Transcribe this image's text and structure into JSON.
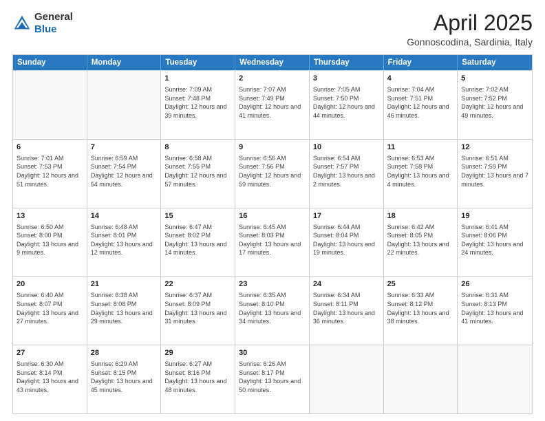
{
  "header": {
    "logo_general": "General",
    "logo_blue": "Blue",
    "month_title": "April 2025",
    "location": "Gonnoscodina, Sardinia, Italy"
  },
  "days": [
    "Sunday",
    "Monday",
    "Tuesday",
    "Wednesday",
    "Thursday",
    "Friday",
    "Saturday"
  ],
  "weeks": [
    [
      {
        "day": "",
        "info": ""
      },
      {
        "day": "",
        "info": ""
      },
      {
        "day": "1",
        "info": "Sunrise: 7:09 AM\nSunset: 7:48 PM\nDaylight: 12 hours and 39 minutes."
      },
      {
        "day": "2",
        "info": "Sunrise: 7:07 AM\nSunset: 7:49 PM\nDaylight: 12 hours and 41 minutes."
      },
      {
        "day": "3",
        "info": "Sunrise: 7:05 AM\nSunset: 7:50 PM\nDaylight: 12 hours and 44 minutes."
      },
      {
        "day": "4",
        "info": "Sunrise: 7:04 AM\nSunset: 7:51 PM\nDaylight: 12 hours and 46 minutes."
      },
      {
        "day": "5",
        "info": "Sunrise: 7:02 AM\nSunset: 7:52 PM\nDaylight: 12 hours and 49 minutes."
      }
    ],
    [
      {
        "day": "6",
        "info": "Sunrise: 7:01 AM\nSunset: 7:53 PM\nDaylight: 12 hours and 51 minutes."
      },
      {
        "day": "7",
        "info": "Sunrise: 6:59 AM\nSunset: 7:54 PM\nDaylight: 12 hours and 54 minutes."
      },
      {
        "day": "8",
        "info": "Sunrise: 6:58 AM\nSunset: 7:55 PM\nDaylight: 12 hours and 57 minutes."
      },
      {
        "day": "9",
        "info": "Sunrise: 6:56 AM\nSunset: 7:56 PM\nDaylight: 12 hours and 59 minutes."
      },
      {
        "day": "10",
        "info": "Sunrise: 6:54 AM\nSunset: 7:57 PM\nDaylight: 13 hours and 2 minutes."
      },
      {
        "day": "11",
        "info": "Sunrise: 6:53 AM\nSunset: 7:58 PM\nDaylight: 13 hours and 4 minutes."
      },
      {
        "day": "12",
        "info": "Sunrise: 6:51 AM\nSunset: 7:59 PM\nDaylight: 13 hours and 7 minutes."
      }
    ],
    [
      {
        "day": "13",
        "info": "Sunrise: 6:50 AM\nSunset: 8:00 PM\nDaylight: 13 hours and 9 minutes."
      },
      {
        "day": "14",
        "info": "Sunrise: 6:48 AM\nSunset: 8:01 PM\nDaylight: 13 hours and 12 minutes."
      },
      {
        "day": "15",
        "info": "Sunrise: 6:47 AM\nSunset: 8:02 PM\nDaylight: 13 hours and 14 minutes."
      },
      {
        "day": "16",
        "info": "Sunrise: 6:45 AM\nSunset: 8:03 PM\nDaylight: 13 hours and 17 minutes."
      },
      {
        "day": "17",
        "info": "Sunrise: 6:44 AM\nSunset: 8:04 PM\nDaylight: 13 hours and 19 minutes."
      },
      {
        "day": "18",
        "info": "Sunrise: 6:42 AM\nSunset: 8:05 PM\nDaylight: 13 hours and 22 minutes."
      },
      {
        "day": "19",
        "info": "Sunrise: 6:41 AM\nSunset: 8:06 PM\nDaylight: 13 hours and 24 minutes."
      }
    ],
    [
      {
        "day": "20",
        "info": "Sunrise: 6:40 AM\nSunset: 8:07 PM\nDaylight: 13 hours and 27 minutes."
      },
      {
        "day": "21",
        "info": "Sunrise: 6:38 AM\nSunset: 8:08 PM\nDaylight: 13 hours and 29 minutes."
      },
      {
        "day": "22",
        "info": "Sunrise: 6:37 AM\nSunset: 8:09 PM\nDaylight: 13 hours and 31 minutes."
      },
      {
        "day": "23",
        "info": "Sunrise: 6:35 AM\nSunset: 8:10 PM\nDaylight: 13 hours and 34 minutes."
      },
      {
        "day": "24",
        "info": "Sunrise: 6:34 AM\nSunset: 8:11 PM\nDaylight: 13 hours and 36 minutes."
      },
      {
        "day": "25",
        "info": "Sunrise: 6:33 AM\nSunset: 8:12 PM\nDaylight: 13 hours and 38 minutes."
      },
      {
        "day": "26",
        "info": "Sunrise: 6:31 AM\nSunset: 8:13 PM\nDaylight: 13 hours and 41 minutes."
      }
    ],
    [
      {
        "day": "27",
        "info": "Sunrise: 6:30 AM\nSunset: 8:14 PM\nDaylight: 13 hours and 43 minutes."
      },
      {
        "day": "28",
        "info": "Sunrise: 6:29 AM\nSunset: 8:15 PM\nDaylight: 13 hours and 45 minutes."
      },
      {
        "day": "29",
        "info": "Sunrise: 6:27 AM\nSunset: 8:16 PM\nDaylight: 13 hours and 48 minutes."
      },
      {
        "day": "30",
        "info": "Sunrise: 6:26 AM\nSunset: 8:17 PM\nDaylight: 13 hours and 50 minutes."
      },
      {
        "day": "",
        "info": ""
      },
      {
        "day": "",
        "info": ""
      },
      {
        "day": "",
        "info": ""
      }
    ]
  ]
}
